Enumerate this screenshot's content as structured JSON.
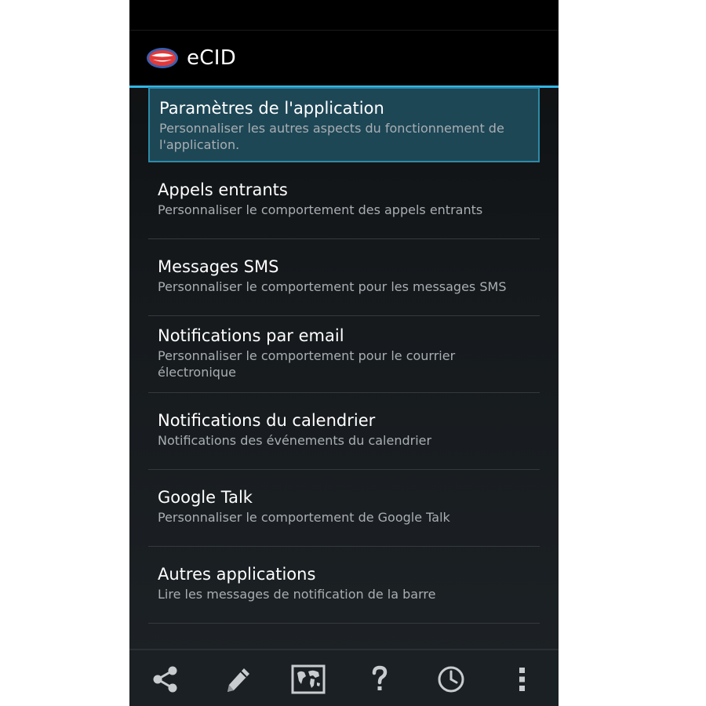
{
  "app": {
    "title": "eCID"
  },
  "settings": {
    "items": [
      {
        "title": "Paramètres de l'application",
        "subtitle": "Personnaliser les autres aspects du fonctionnement de l'application."
      },
      {
        "title": "Appels entrants",
        "subtitle": "Personnaliser le comportement des appels entrants"
      },
      {
        "title": "Messages SMS",
        "subtitle": "Personnaliser le comportement pour les messages SMS"
      },
      {
        "title": "Notifications par email",
        "subtitle": "Personnaliser le comportement pour le courrier électronique"
      },
      {
        "title": "Notifications du calendrier",
        "subtitle": "Notifications des événements du calendrier"
      },
      {
        "title": "Google Talk",
        "subtitle": "Personnaliser le comportement de Google Talk"
      },
      {
        "title": "Autres applications",
        "subtitle": "Lire les messages de notification de la barre"
      }
    ]
  },
  "bottom_bar": {
    "buttons": [
      {
        "icon": "share-icon"
      },
      {
        "icon": "pencil-icon"
      },
      {
        "icon": "world-map-icon"
      },
      {
        "icon": "help-icon"
      },
      {
        "icon": "clock-icon"
      },
      {
        "icon": "overflow-menu-icon"
      }
    ]
  },
  "colors": {
    "accent": "#33b5e5",
    "selected_bg": "#1e4756",
    "selected_border": "#2d8aa8"
  }
}
